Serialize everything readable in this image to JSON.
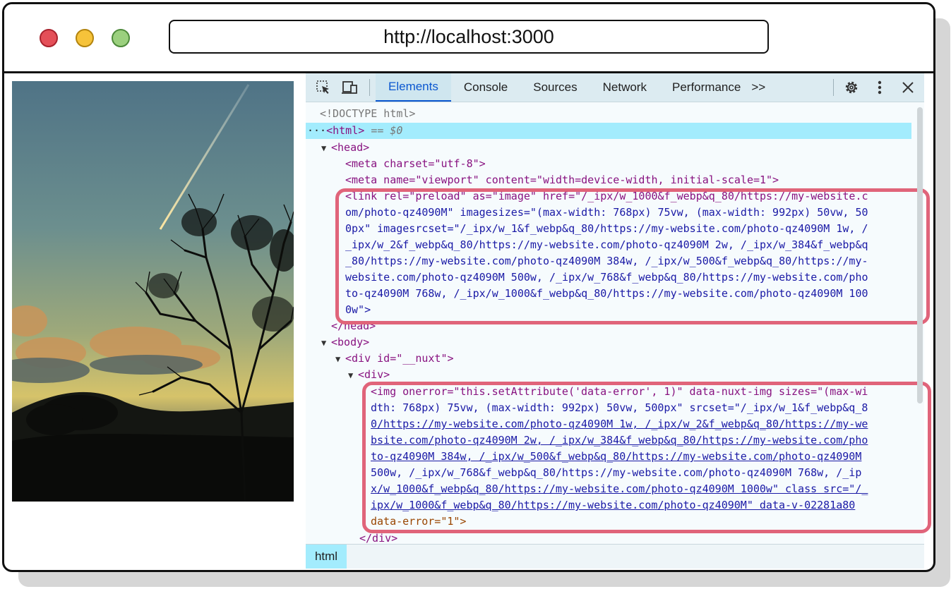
{
  "browser": {
    "url": "http://localhost:3000"
  },
  "devtools": {
    "tabs": [
      "Elements",
      "Console",
      "Sources",
      "Network",
      "Performance"
    ],
    "active_tab": "Elements",
    "more_tabs_label": ">>",
    "breadcrumb": "html"
  },
  "code_lines": [
    "<!DOCTYPE html>",
    "<html>",
    "== $0",
    "<head>",
    "<meta charset=\"utf-8\">",
    "<meta name=\"viewport\" content=\"width=device-width, initial-scale=1\">",
    "<link rel=\"preload\" as=\"image\" href=\"/_ipx/w_1000&f_webp&q_80/https://my-website.c",
    "om/photo-qz4090M\" imagesizes=\"(max-width: 768px) 75vw, (max-width: 992px) 50vw, 50",
    "0px\" imagesrcset=\"/_ipx/w_1&f_webp&q_80/https://my-website.com/photo-qz4090M 1w, /",
    "_ipx/w_2&f_webp&q_80/https://my-website.com/photo-qz4090M 2w, /_ipx/w_384&f_webp&q",
    "_80/https://my-website.com/photo-qz4090M 384w, /_ipx/w_500&f_webp&q_80/https://my-",
    "website.com/photo-qz4090M 500w, /_ipx/w_768&f_webp&q_80/https://my-website.com/pho",
    "to-qz4090M 768w, /_ipx/w_1000&f_webp&q_80/https://my-website.com/photo-qz4090M 100",
    "0w\">",
    "</head>",
    "<body>",
    "<div id=\"__nuxt\">",
    "<div>",
    "<img onerror=\"this.setAttribute('data-error', 1)\" data-nuxt-img sizes=\"(max-wi",
    "dth: 768px) 75vw, (max-width: 992px) 50vw, 500px\" srcset=\"/_ipx/w_1&f_webp&q_8",
    "0/https://my-website.com/photo-qz4090M 1w, /_ipx/w_2&f_webp&q_80/https://my-we",
    "bsite.com/photo-qz4090M 2w, /_ipx/w_384&f_webp&q_80/https://my-website.com/pho",
    "to-qz4090M 384w, /_ipx/w_500&f_webp&q_80/https://my-website.com/photo-qz4090M",
    "500w, /_ipx/w_768&f_webp&q_80/https://my-website.com/photo-qz4090M 768w, /_ip",
    "x/w_1000&f_webp&q_80/https://my-website.com/photo-qz4090M 1000w\" class src=\"/_",
    "ipx/w_1000&f_webp&q_80/https://my-website.com/photo-qz4090M\" data-v-02281a80",
    "data-error=\"1\">",
    "</div>"
  ],
  "colors": {
    "highlight_border": "#e0647a",
    "selected_row": "#a3ecfd",
    "tag": "#881280",
    "attr_name": "#994500",
    "attr_value": "#1a1aa6"
  },
  "icons": [
    "inspect-element-icon",
    "device-toolbar-icon",
    "more-tabs-icon",
    "settings-gear-icon",
    "kebab-menu-icon",
    "close-icon"
  ]
}
